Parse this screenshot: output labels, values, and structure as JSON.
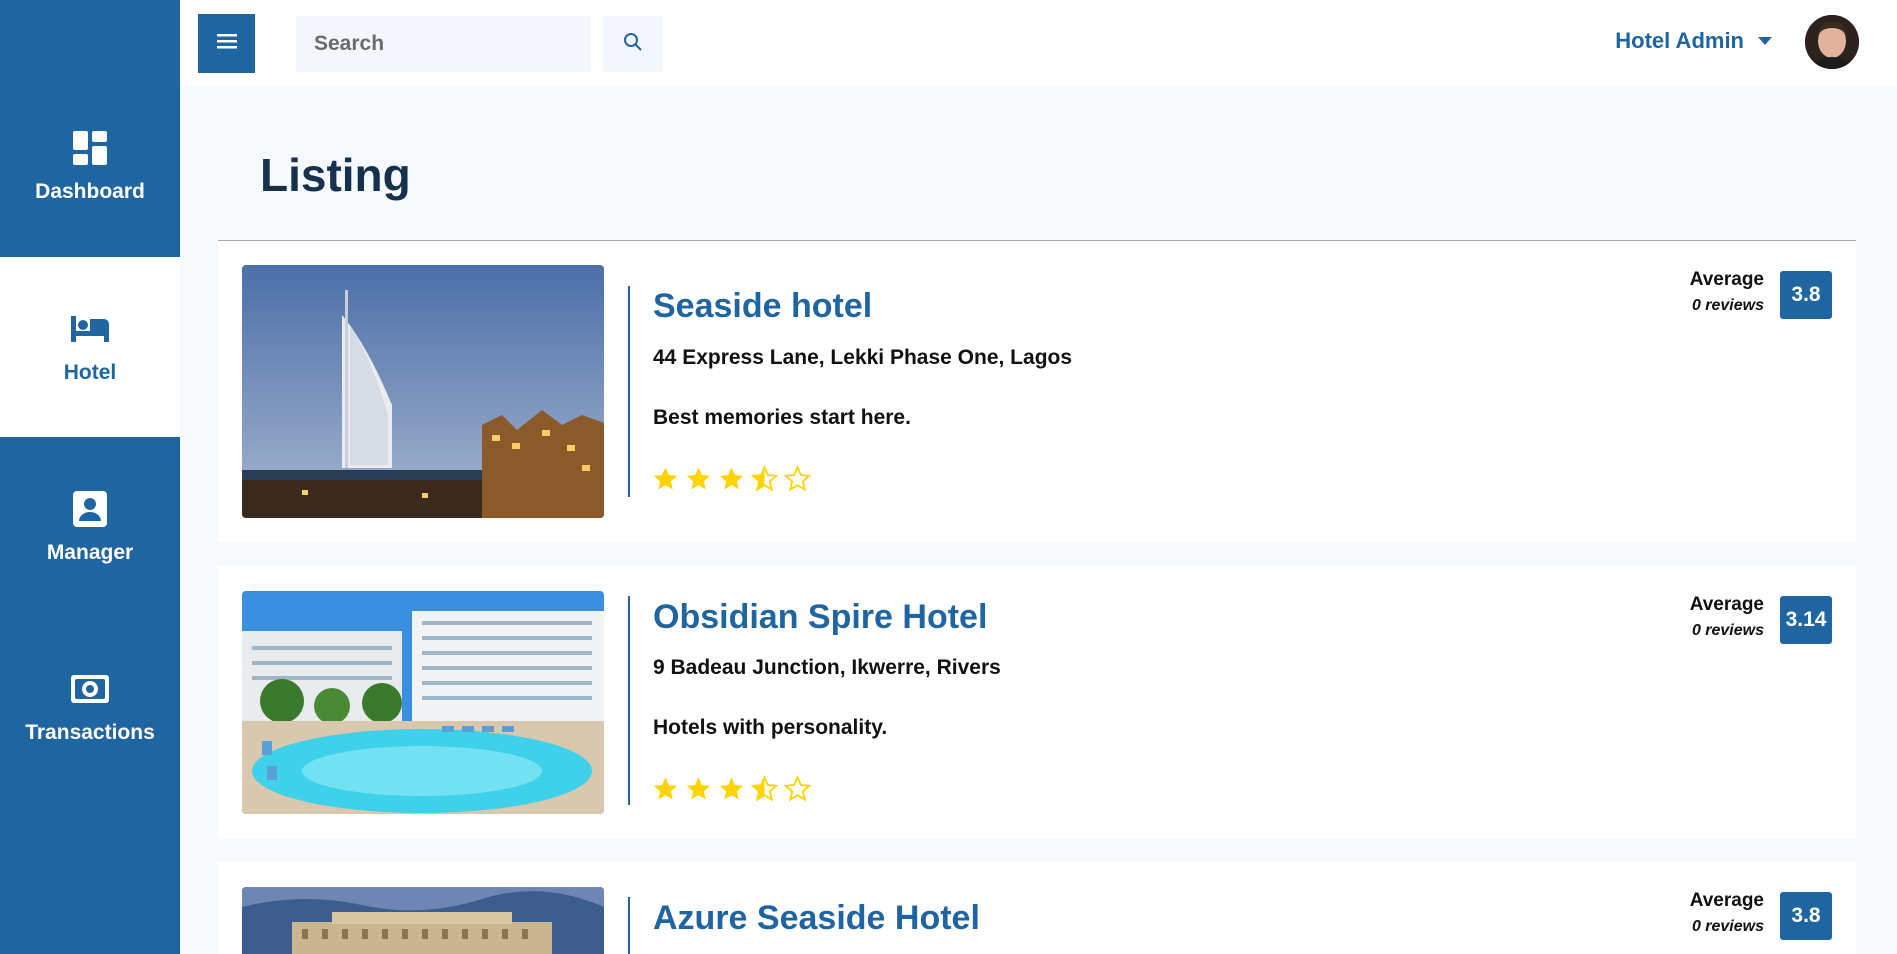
{
  "sidebar": {
    "items": [
      {
        "label": "Dashboard",
        "icon": "dashboard-icon",
        "active": false
      },
      {
        "label": "Hotel",
        "icon": "bed-icon",
        "active": true
      },
      {
        "label": "Manager",
        "icon": "user-badge-icon",
        "active": false
      },
      {
        "label": "Transactions",
        "icon": "cash-icon",
        "active": false
      }
    ]
  },
  "header": {
    "menu_icon": "hamburger-icon",
    "search_placeholder": "Search",
    "search_icon": "search-icon",
    "user_name": "Hotel Admin",
    "user_menu_icon": "caret-down-icon"
  },
  "page": {
    "title": "Listing"
  },
  "listings": [
    {
      "name": "Seaside hotel",
      "address": "44 Express Lane, Lekki Phase One, Lagos",
      "tagline": "Best memories start here.",
      "rating_stars": 3.5,
      "average_label": "Average",
      "reviews": "0 reviews",
      "score": "3.8"
    },
    {
      "name": "Obsidian Spire Hotel",
      "address": "9 Badeau Junction, Ikwerre, Rivers",
      "tagline": "Hotels with personality.",
      "rating_stars": 3.5,
      "average_label": "Average",
      "reviews": "0 reviews",
      "score": "3.14"
    },
    {
      "name": "Azure Seaside Hotel",
      "average_label": "Average",
      "reviews": "0 reviews",
      "score": "3.8"
    }
  ],
  "colors": {
    "primary": "#1f65a1",
    "star": "#ffd400",
    "title": "#16304d"
  }
}
